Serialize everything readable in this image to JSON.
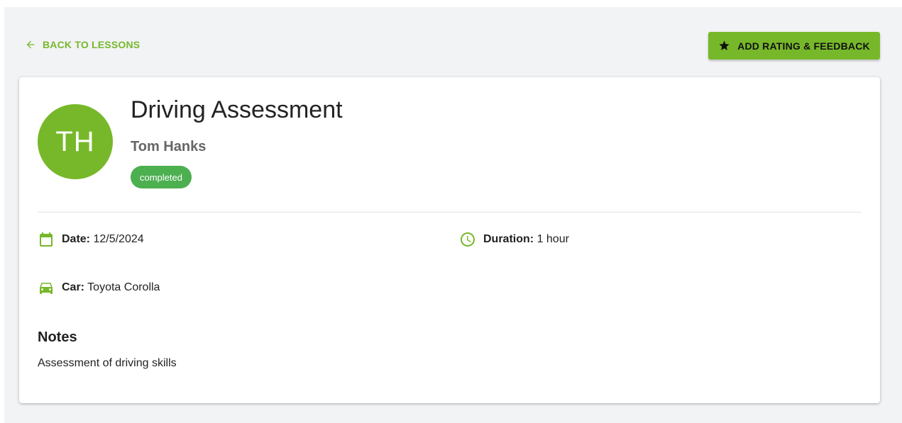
{
  "header": {
    "back_label": "BACK TO LESSONS",
    "back_icon": "arrow-left-icon",
    "rating_button_label": "ADD RATING & FEEDBACK",
    "rating_icon": "star-icon"
  },
  "lesson": {
    "avatar_initials": "TH",
    "title": "Driving Assessment",
    "student_name": "Tom Hanks",
    "status": "completed",
    "details": {
      "date_label": "Date:",
      "date_value": "12/5/2024",
      "duration_label": "Duration:",
      "duration_value": "1 hour",
      "car_label": "Car:",
      "car_value": "Toyota Corolla"
    },
    "notes_heading": "Notes",
    "notes_text": "Assessment of driving skills"
  },
  "colors": {
    "accent": "#77b82a",
    "status_completed": "#4caf50",
    "background": "#f2f3f5"
  }
}
